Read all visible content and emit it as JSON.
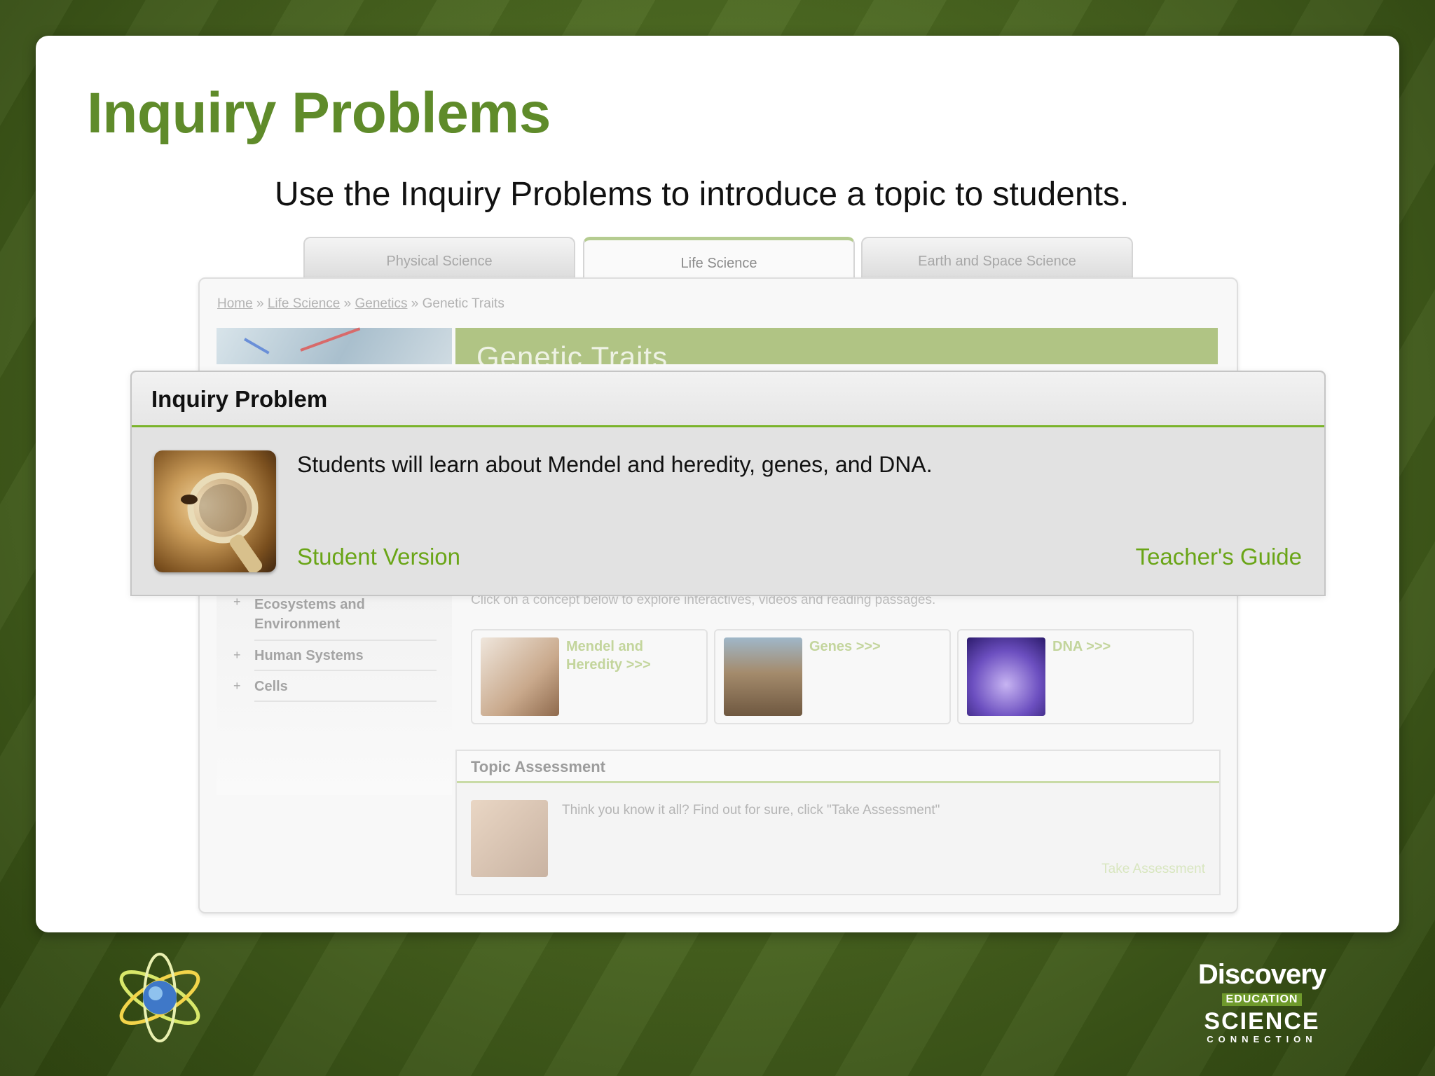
{
  "slide": {
    "title": "Inquiry Problems",
    "subtitle": "Use the Inquiry Problems to introduce a topic to students."
  },
  "website": {
    "tabs": [
      {
        "label": "Physical Science",
        "active": false
      },
      {
        "label": "Life Science",
        "active": true
      },
      {
        "label": "Earth and Space Science",
        "active": false
      }
    ],
    "breadcrumb": [
      "Home",
      "Life Science",
      "Genetics",
      "Genetic Traits"
    ],
    "breadcrumb_separators": [
      "»",
      "»",
      "»"
    ],
    "page_heading": "Genetic Traits",
    "side_nav": [
      "Ecosystems and Environment",
      "Human Systems",
      "Cells"
    ],
    "concept_instruction": "Click on a concept below to explore interactives, videos and reading passages.",
    "concepts": [
      {
        "label": "Mendel and Heredity >>>"
      },
      {
        "label": "Genes >>>"
      },
      {
        "label": "DNA >>>"
      }
    ],
    "assessment": {
      "heading": "Topic Assessment",
      "text": "Think you know it all? Find out for sure, click \"Take Assessment\"",
      "link": "Take Assessment"
    }
  },
  "inquiry": {
    "heading": "Inquiry Problem",
    "description": "Students will learn about Mendel and heredity, genes, and DNA.",
    "student_link": "Student Version",
    "teacher_link": "Teacher's Guide"
  },
  "brand": {
    "discovery": "Discovery",
    "education": "EDUCATION",
    "science": "SCIENCE",
    "connection": "CONNECTION"
  },
  "colors": {
    "title_green": "#5f8b2a",
    "link_green": "#6aa517",
    "header_green": "#b0c484"
  }
}
